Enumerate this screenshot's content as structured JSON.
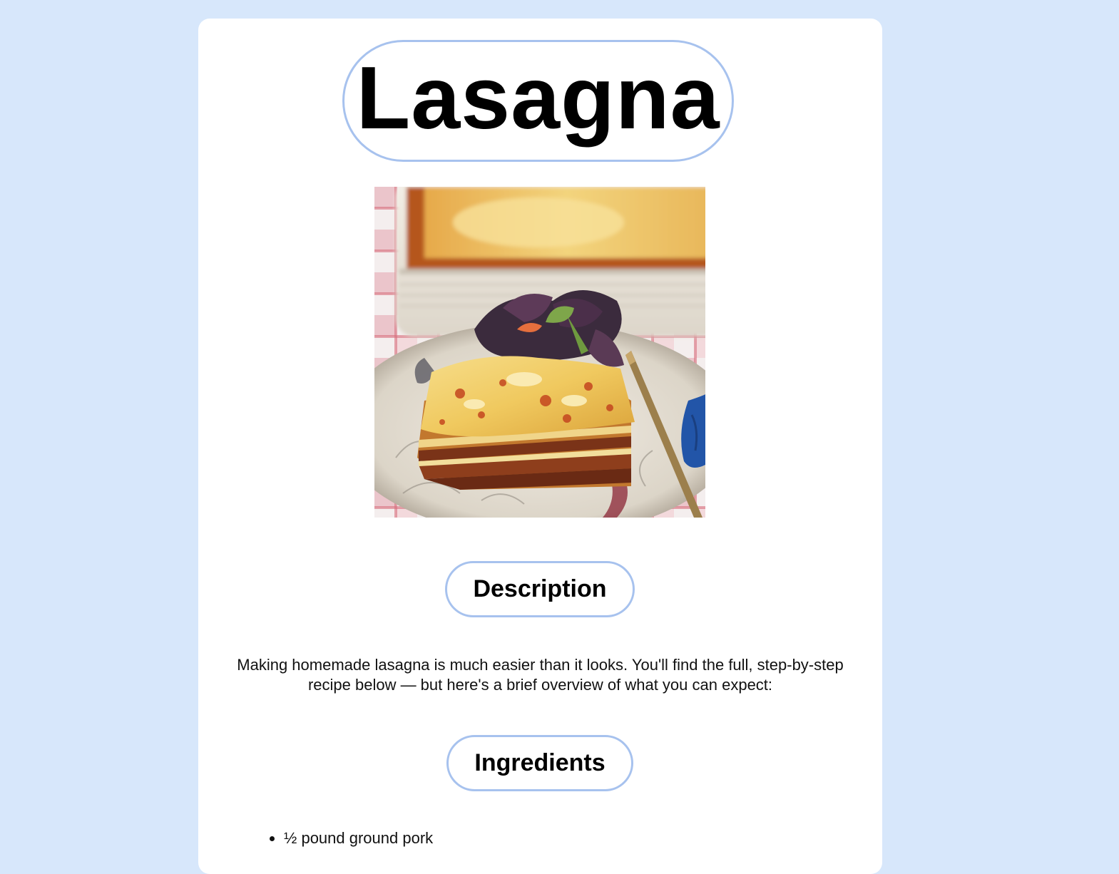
{
  "recipe": {
    "title": "Lasagna",
    "image_alt": "Lasagna slice on a plate with salad and baking dish",
    "sections": {
      "description_heading": "Description",
      "ingredients_heading": "Ingredients"
    },
    "description": "Making homemade lasagna is much easier than it looks. You'll find the full, step-by-step recipe below — but here's a brief overview of what you can expect:",
    "ingredients": [
      "½ pound ground pork"
    ]
  },
  "colors": {
    "page_background": "#d7e7fb",
    "card_background": "#ffffff",
    "pill_border": "#a7c2ee"
  }
}
